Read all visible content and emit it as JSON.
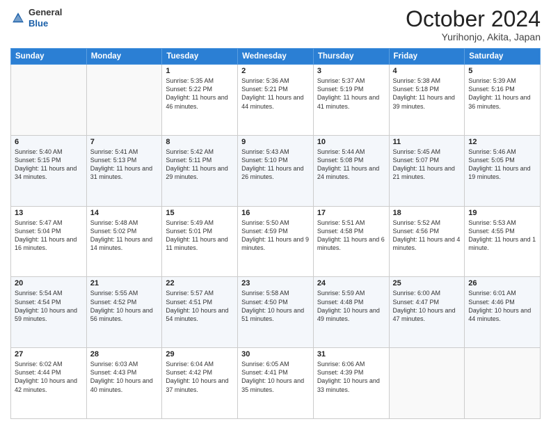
{
  "logo": {
    "line1": "General",
    "line2": "Blue"
  },
  "header": {
    "month": "October 2024",
    "location": "Yurihonjo, Akita, Japan"
  },
  "weekdays": [
    "Sunday",
    "Monday",
    "Tuesday",
    "Wednesday",
    "Thursday",
    "Friday",
    "Saturday"
  ],
  "weeks": [
    [
      {
        "day": "",
        "content": ""
      },
      {
        "day": "",
        "content": ""
      },
      {
        "day": "1",
        "content": "Sunrise: 5:35 AM\nSunset: 5:22 PM\nDaylight: 11 hours and 46 minutes."
      },
      {
        "day": "2",
        "content": "Sunrise: 5:36 AM\nSunset: 5:21 PM\nDaylight: 11 hours and 44 minutes."
      },
      {
        "day": "3",
        "content": "Sunrise: 5:37 AM\nSunset: 5:19 PM\nDaylight: 11 hours and 41 minutes."
      },
      {
        "day": "4",
        "content": "Sunrise: 5:38 AM\nSunset: 5:18 PM\nDaylight: 11 hours and 39 minutes."
      },
      {
        "day": "5",
        "content": "Sunrise: 5:39 AM\nSunset: 5:16 PM\nDaylight: 11 hours and 36 minutes."
      }
    ],
    [
      {
        "day": "6",
        "content": "Sunrise: 5:40 AM\nSunset: 5:15 PM\nDaylight: 11 hours and 34 minutes."
      },
      {
        "day": "7",
        "content": "Sunrise: 5:41 AM\nSunset: 5:13 PM\nDaylight: 11 hours and 31 minutes."
      },
      {
        "day": "8",
        "content": "Sunrise: 5:42 AM\nSunset: 5:11 PM\nDaylight: 11 hours and 29 minutes."
      },
      {
        "day": "9",
        "content": "Sunrise: 5:43 AM\nSunset: 5:10 PM\nDaylight: 11 hours and 26 minutes."
      },
      {
        "day": "10",
        "content": "Sunrise: 5:44 AM\nSunset: 5:08 PM\nDaylight: 11 hours and 24 minutes."
      },
      {
        "day": "11",
        "content": "Sunrise: 5:45 AM\nSunset: 5:07 PM\nDaylight: 11 hours and 21 minutes."
      },
      {
        "day": "12",
        "content": "Sunrise: 5:46 AM\nSunset: 5:05 PM\nDaylight: 11 hours and 19 minutes."
      }
    ],
    [
      {
        "day": "13",
        "content": "Sunrise: 5:47 AM\nSunset: 5:04 PM\nDaylight: 11 hours and 16 minutes."
      },
      {
        "day": "14",
        "content": "Sunrise: 5:48 AM\nSunset: 5:02 PM\nDaylight: 11 hours and 14 minutes."
      },
      {
        "day": "15",
        "content": "Sunrise: 5:49 AM\nSunset: 5:01 PM\nDaylight: 11 hours and 11 minutes."
      },
      {
        "day": "16",
        "content": "Sunrise: 5:50 AM\nSunset: 4:59 PM\nDaylight: 11 hours and 9 minutes."
      },
      {
        "day": "17",
        "content": "Sunrise: 5:51 AM\nSunset: 4:58 PM\nDaylight: 11 hours and 6 minutes."
      },
      {
        "day": "18",
        "content": "Sunrise: 5:52 AM\nSunset: 4:56 PM\nDaylight: 11 hours and 4 minutes."
      },
      {
        "day": "19",
        "content": "Sunrise: 5:53 AM\nSunset: 4:55 PM\nDaylight: 11 hours and 1 minute."
      }
    ],
    [
      {
        "day": "20",
        "content": "Sunrise: 5:54 AM\nSunset: 4:54 PM\nDaylight: 10 hours and 59 minutes."
      },
      {
        "day": "21",
        "content": "Sunrise: 5:55 AM\nSunset: 4:52 PM\nDaylight: 10 hours and 56 minutes."
      },
      {
        "day": "22",
        "content": "Sunrise: 5:57 AM\nSunset: 4:51 PM\nDaylight: 10 hours and 54 minutes."
      },
      {
        "day": "23",
        "content": "Sunrise: 5:58 AM\nSunset: 4:50 PM\nDaylight: 10 hours and 51 minutes."
      },
      {
        "day": "24",
        "content": "Sunrise: 5:59 AM\nSunset: 4:48 PM\nDaylight: 10 hours and 49 minutes."
      },
      {
        "day": "25",
        "content": "Sunrise: 6:00 AM\nSunset: 4:47 PM\nDaylight: 10 hours and 47 minutes."
      },
      {
        "day": "26",
        "content": "Sunrise: 6:01 AM\nSunset: 4:46 PM\nDaylight: 10 hours and 44 minutes."
      }
    ],
    [
      {
        "day": "27",
        "content": "Sunrise: 6:02 AM\nSunset: 4:44 PM\nDaylight: 10 hours and 42 minutes."
      },
      {
        "day": "28",
        "content": "Sunrise: 6:03 AM\nSunset: 4:43 PM\nDaylight: 10 hours and 40 minutes."
      },
      {
        "day": "29",
        "content": "Sunrise: 6:04 AM\nSunset: 4:42 PM\nDaylight: 10 hours and 37 minutes."
      },
      {
        "day": "30",
        "content": "Sunrise: 6:05 AM\nSunset: 4:41 PM\nDaylight: 10 hours and 35 minutes."
      },
      {
        "day": "31",
        "content": "Sunrise: 6:06 AM\nSunset: 4:39 PM\nDaylight: 10 hours and 33 minutes."
      },
      {
        "day": "",
        "content": ""
      },
      {
        "day": "",
        "content": ""
      }
    ]
  ]
}
